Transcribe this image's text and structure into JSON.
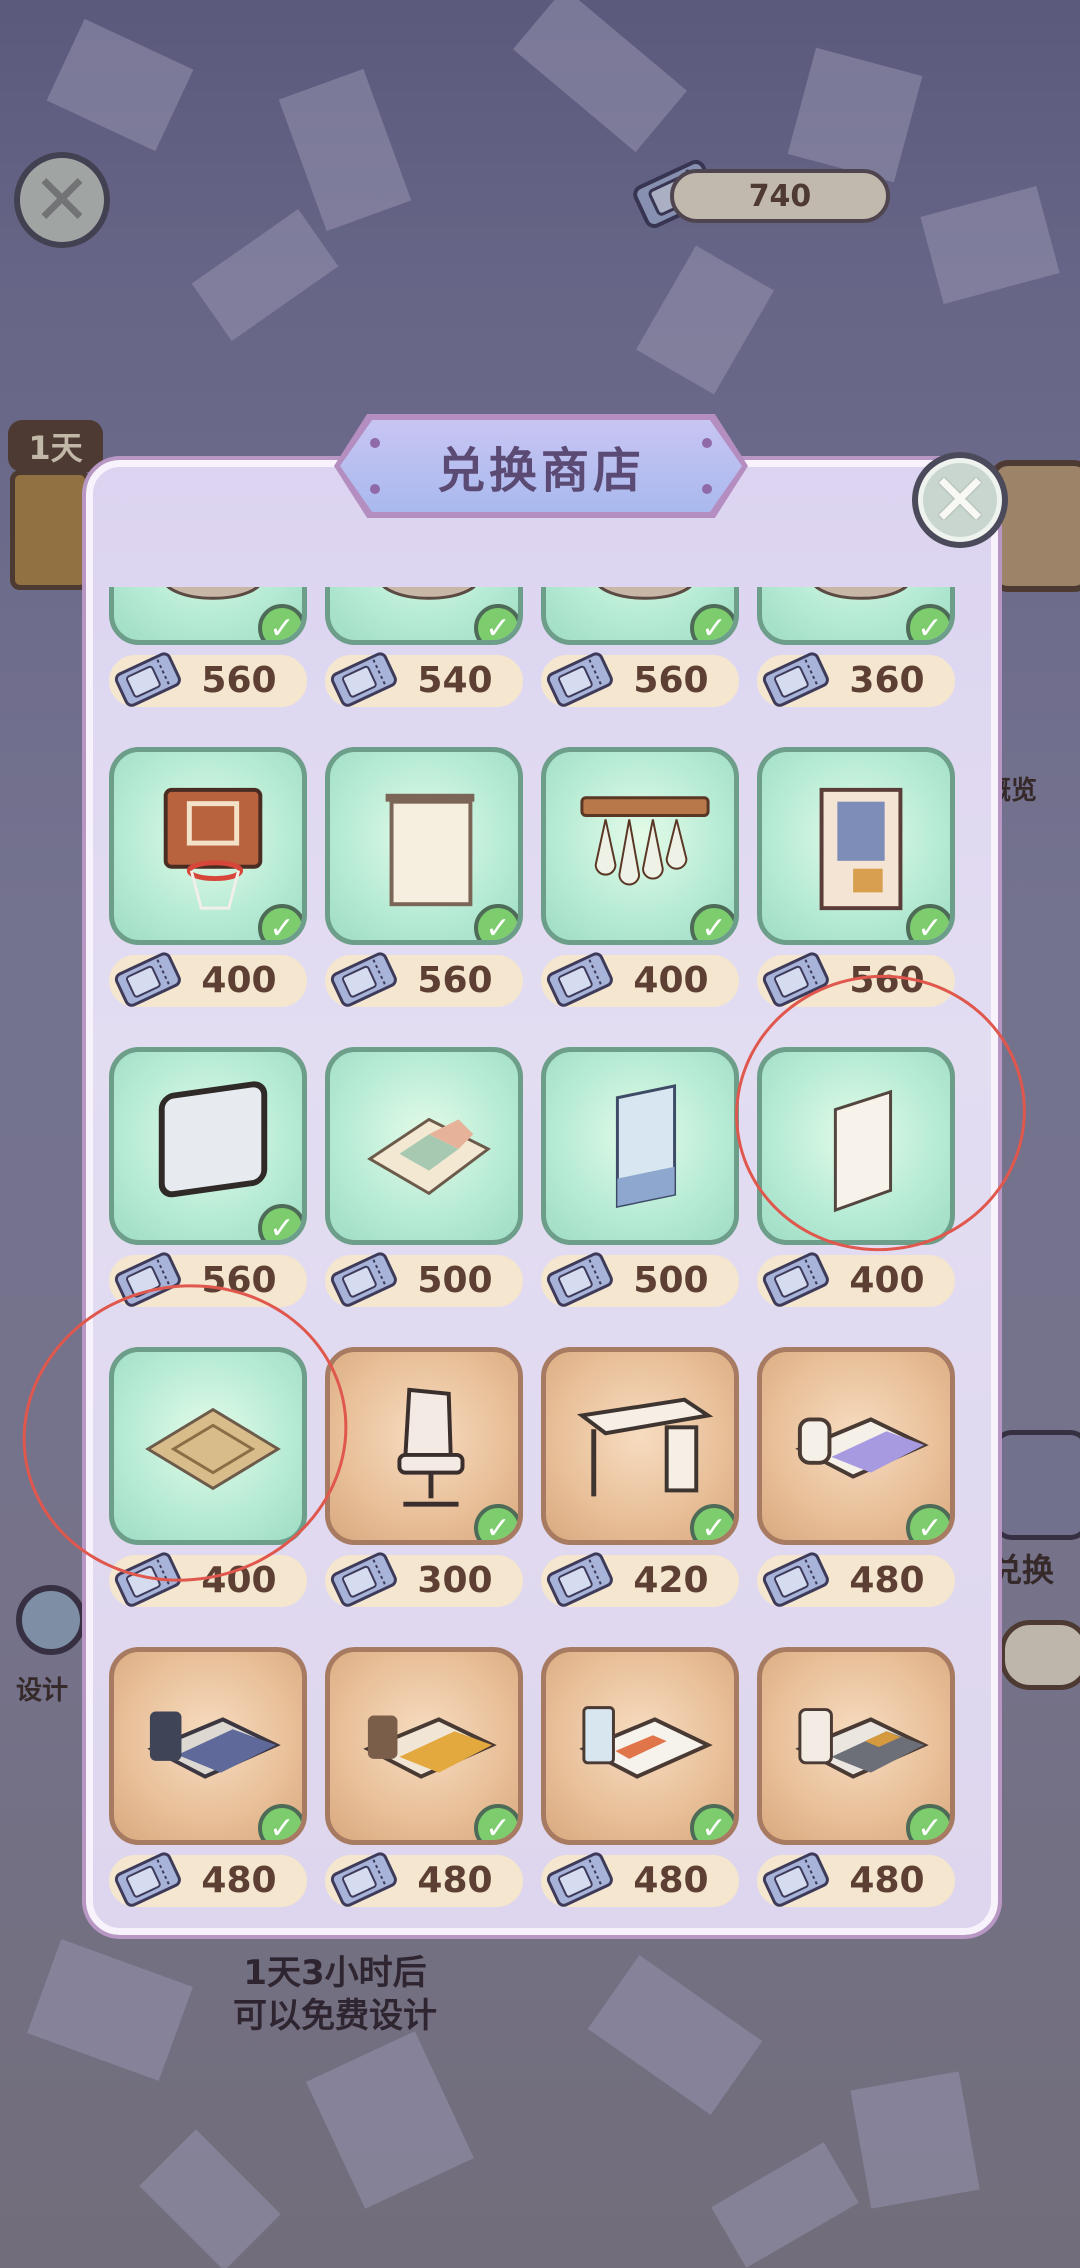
{
  "currency": {
    "amount": "740",
    "icon": "ticket-icon"
  },
  "side": {
    "day_badge": "1天",
    "overview_label": "概览",
    "exchange_label": "兑换",
    "design_label": "设计"
  },
  "bottom": {
    "line1": "1天3小时后",
    "line2": "可以免费设计"
  },
  "shop": {
    "title": "兑换商店",
    "rows": [
      [
        {
          "price": "560",
          "owned": true,
          "bg": "green",
          "icon": "furniture-icon"
        },
        {
          "price": "540",
          "owned": true,
          "bg": "green",
          "icon": "furniture-icon"
        },
        {
          "price": "560",
          "owned": true,
          "bg": "green",
          "icon": "furniture-icon"
        },
        {
          "price": "360",
          "owned": true,
          "bg": "green",
          "icon": "furniture-icon"
        }
      ],
      [
        {
          "price": "400",
          "owned": true,
          "bg": "green",
          "icon": "basketball-hoop-icon"
        },
        {
          "price": "560",
          "owned": true,
          "bg": "green",
          "icon": "projector-screen-icon"
        },
        {
          "price": "400",
          "owned": true,
          "bg": "green",
          "icon": "wine-glass-rack-icon"
        },
        {
          "price": "560",
          "owned": true,
          "bg": "green",
          "icon": "photo-wall-icon"
        }
      ],
      [
        {
          "price": "560",
          "owned": true,
          "bg": "green",
          "icon": "mirror-icon"
        },
        {
          "price": "500",
          "owned": false,
          "bg": "green",
          "icon": "patchwork-rug-icon"
        },
        {
          "price": "500",
          "owned": false,
          "bg": "green",
          "icon": "wall-poster-icon"
        },
        {
          "price": "400",
          "owned": false,
          "bg": "green",
          "icon": "wallpaper-panel-icon"
        }
      ],
      [
        {
          "price": "400",
          "owned": false,
          "bg": "green",
          "icon": "geometric-rug-icon"
        },
        {
          "price": "300",
          "owned": true,
          "bg": "tan",
          "icon": "office-chair-icon"
        },
        {
          "price": "420",
          "owned": true,
          "bg": "tan",
          "icon": "desk-icon"
        },
        {
          "price": "480",
          "owned": true,
          "bg": "tan",
          "icon": "purple-bed-icon"
        }
      ],
      [
        {
          "price": "480",
          "owned": true,
          "bg": "tan",
          "icon": "navy-bed-icon"
        },
        {
          "price": "480",
          "owned": true,
          "bg": "tan",
          "icon": "yellow-bed-icon"
        },
        {
          "price": "480",
          "owned": true,
          "bg": "tan",
          "icon": "orange-bed-icon"
        },
        {
          "price": "480",
          "owned": true,
          "bg": "tan",
          "icon": "gray-bed-icon"
        }
      ]
    ]
  },
  "colors": {
    "accent": "#e0574d",
    "price_text": "#5d3f33",
    "check": "#7dcc6e"
  }
}
